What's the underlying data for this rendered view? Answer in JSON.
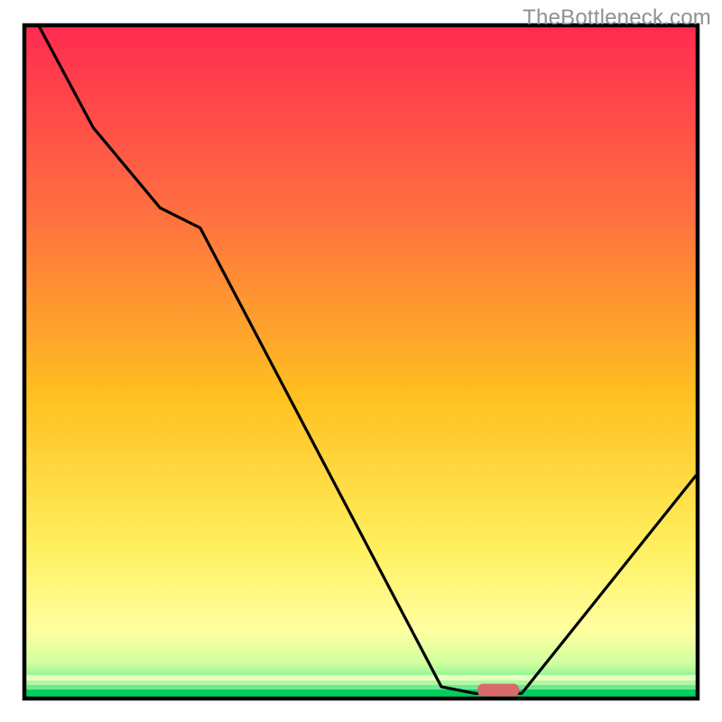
{
  "watermark": "TheBottleneck.com",
  "chart_data": {
    "type": "line",
    "title": "",
    "xlabel": "",
    "ylabel": "",
    "xlim": [
      0,
      100
    ],
    "ylim": [
      0,
      100
    ],
    "x": [
      2,
      10,
      20,
      26,
      62,
      67,
      74,
      100
    ],
    "values": [
      100,
      85,
      73,
      70,
      1.5,
      0.5,
      0.5,
      33
    ],
    "marker": {
      "x": 70.5,
      "y": 1.0
    },
    "background_bands": [
      {
        "color": "#ff2b50",
        "y0": 100,
        "y1": 72
      },
      {
        "color": "#ff8040",
        "y0": 72,
        "y1": 45
      },
      {
        "color": "#ffd020",
        "y0": 45,
        "y1": 20
      },
      {
        "color": "#fff060",
        "y0": 20,
        "y1": 8
      },
      {
        "color": "#b8ff80",
        "y0": 8,
        "y1": 3
      },
      {
        "color": "#00e070",
        "y0": 3,
        "y1": 0
      }
    ],
    "marker_color": "#d86a6a",
    "line_color": "#000000",
    "frame_color": "#000000"
  }
}
